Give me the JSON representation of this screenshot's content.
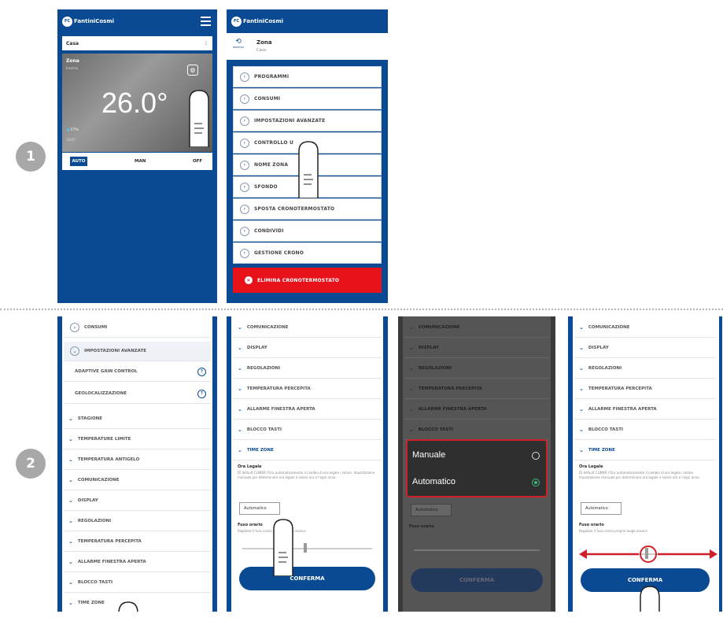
{
  "steps": [
    "1",
    "2"
  ],
  "brand": "FantiniCosmi",
  "screen1": {
    "house_label": "Casa",
    "zone_label": "Zona",
    "zone_sub": "Inverno",
    "temperature": "26.0°",
    "humidity": "57%",
    "setpoint": "18.0°",
    "modes": [
      "AUTO",
      "MAN",
      "OFF"
    ]
  },
  "screen2": {
    "back_label": "INDIETRO",
    "zone_title": "Zona",
    "zone_sub": "Casa",
    "menu": [
      "PROGRAMMI",
      "CONSUMI",
      "IMPOSTAZIONI AVANZATE",
      "CONTROLLO U",
      "NOME ZONA",
      "SFONDO",
      "SPOSTA CRONOTERMOSTATO",
      "CONDIVIDI",
      "GESTIONE CRONO"
    ],
    "delete_label": "ELIMINA CRONOTERMOSTATO"
  },
  "screen3": {
    "header_items": [
      "CONSUMI",
      "IMPOSTAZIONI AVANZATE"
    ],
    "sub_items": [
      "ADAPTIVE GAIN CONTROL",
      "GEOLOCALIZZAZIONE"
    ],
    "items": [
      "STAGIONE",
      "TEMPERATURE LIMITE",
      "TEMPERATURA ANTIGELO",
      "COMUNICAZIONE",
      "DISPLAY",
      "REGOLAZIONI",
      "TEMPERATURA PERCEPITA",
      "ALLARME FINESTRA APERTA",
      "BLOCCO TASTI",
      "TIME ZONE"
    ]
  },
  "screen4": {
    "items": [
      "COMUNICAZIONE",
      "DISPLAY",
      "REGOLAZIONI",
      "TEMPERATURA PERCEPITA",
      "ALLARME FINESTRA APERTA",
      "BLOCCO TASTI",
      "TIME ZONE"
    ],
    "ora_legale_label": "Ora Legale",
    "ora_legale_text": "Di default CLIMER l'Ora automaticamente il cambio di ora legale / solare. Impostazione manuale per determinare ora legale e solare ora e l'ogni anno.",
    "select_value": "Automatico",
    "fuso_label": "Fuso orario",
    "fuso_text": "Regolare il fuso orario proprio luogo arance",
    "confirm_label": "CONFERMA"
  },
  "screen5": {
    "items": [
      "COMUNICAZIONE",
      "DISPLAY",
      "REGOLAZIONI",
      "TEMPERATURA PERCEPITA",
      "ALLARME FINESTRA APERTA",
      "BLOCCO TASTI"
    ],
    "select_value": "Automatico",
    "fuso_label": "Fuso orario",
    "options": [
      "Manuale",
      "Automatico"
    ],
    "confirm_label": "CONFERMA"
  },
  "screen6": {
    "items": [
      "COMUNICAZIONE",
      "DISPLAY",
      "REGOLAZIONI",
      "TEMPERATURA PERCEPITA",
      "ALLARME FINESTRA APERTA",
      "BLOCCO TASTI",
      "TIME ZONE"
    ],
    "ora_legale_label": "Ora Legale",
    "ora_legale_text": "Di default CLIMER l'Ora automaticamente il cambio di ora legale / solare. Impostazione manuale per determinare ora legale e solare ora e l'ogni anno.",
    "select_value": "Automatico",
    "fuso_label": "Fuso orario",
    "fuso_text": "Regolare il fuso orario proprio luogo arance",
    "confirm_label": "CONFERMA"
  },
  "colors": {
    "brand_blue": "#0a4a92",
    "delete_red": "#e8121b",
    "highlight_red": "#d0202a",
    "arrow_red": "#d0202a"
  }
}
